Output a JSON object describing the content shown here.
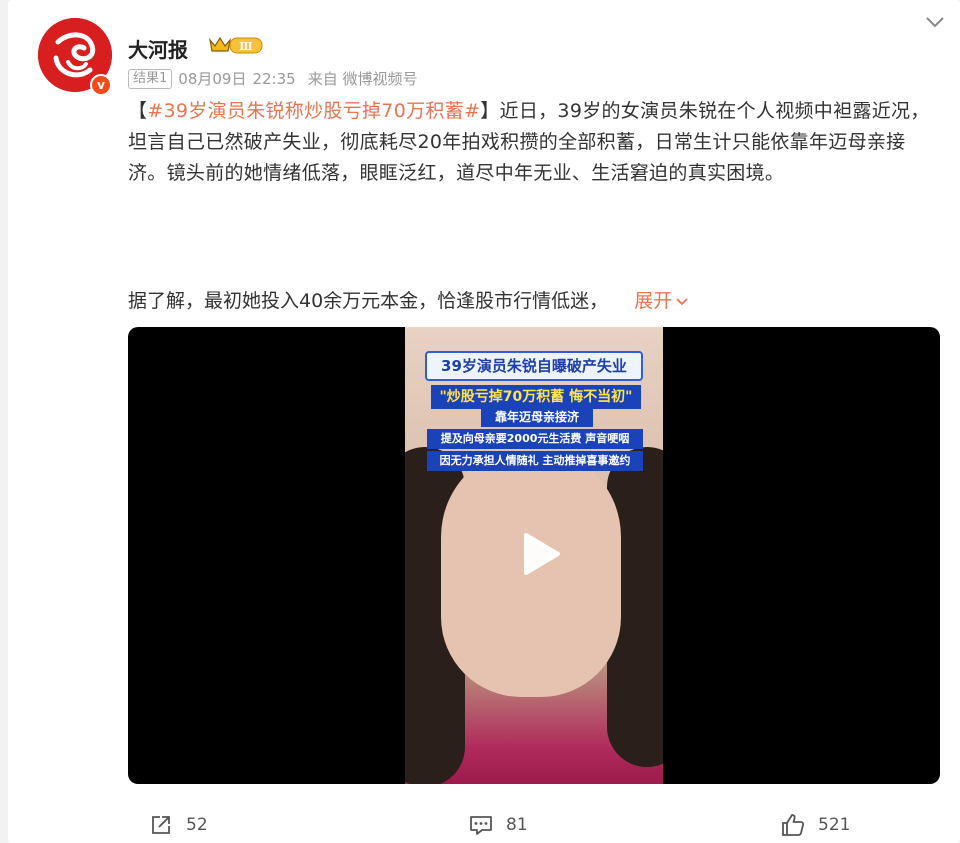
{
  "author": {
    "name": "大河报",
    "verified_mark": "v",
    "level_badge": "Ⅲ",
    "avatar_color": "#d81e1e"
  },
  "meta": {
    "tag": "结果1",
    "date": "08月09日",
    "time": "22:35",
    "source": "来自 微博视频号"
  },
  "post": {
    "bracket_open": "【",
    "hashtag": "#39岁演员朱锐称炒股亏掉70万积蓄#",
    "bracket_close": "】",
    "body": "近日，39岁的女演员朱锐在个人视频中袒露近况，坦言自己已然破产失业，彻底耗尽20年拍戏积攒的全部积蓄，日常生计只能依靠年迈母亲接济。镜头前的她情绪低落，眼眶泛红，道尽中年无业、生活窘迫的真实困境。",
    "para2": "据了解，最初她投入40余万元本金，恰逢股市行情低迷，",
    "expand_label": "展开"
  },
  "video": {
    "caption1": "39岁演员朱锐自曝破产失业",
    "caption2": "\"炒股亏掉70万积蓄 悔不当初\"",
    "caption3": "靠年迈母亲接济",
    "caption4": "提及向母亲要2000元生活费 声音哽咽",
    "caption5": "因无力承担人情随礼 主动推掉喜事邀约"
  },
  "actions": {
    "share_count": "52",
    "comment_count": "81",
    "like_count": "521"
  },
  "colors": {
    "accent": "#eb7350",
    "caption_blue": "#1b43b9"
  }
}
